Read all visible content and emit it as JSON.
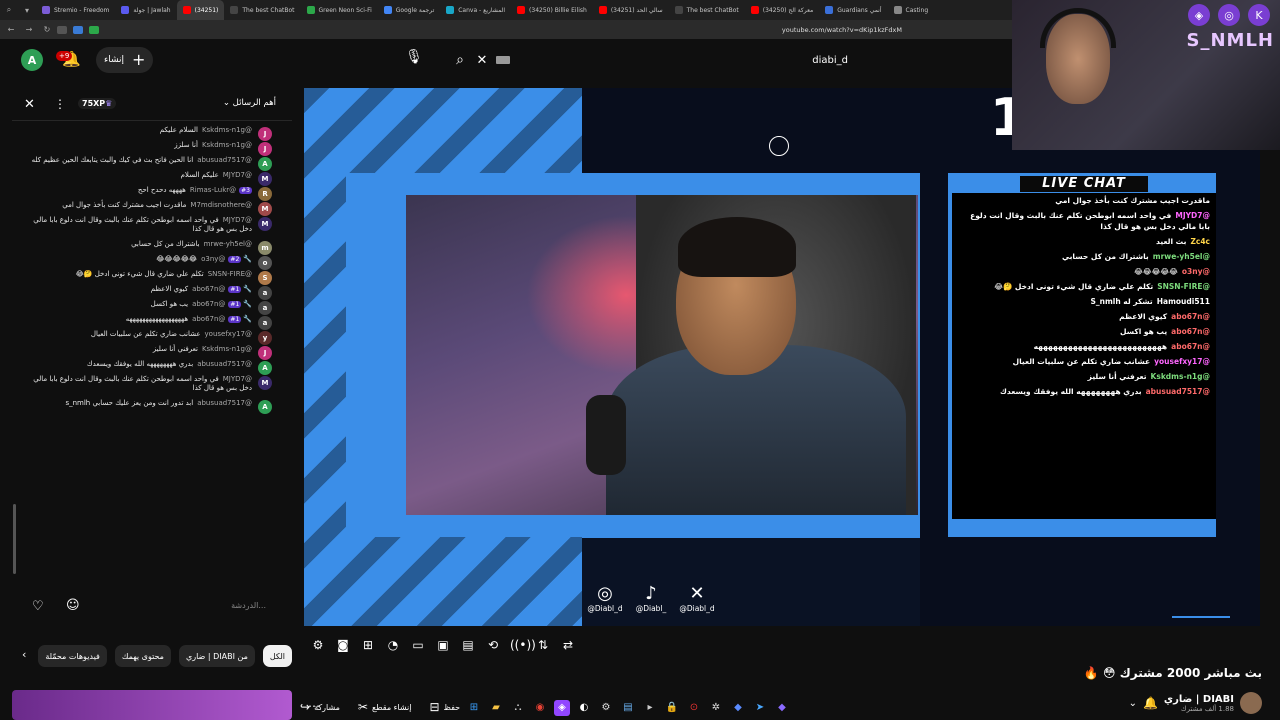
{
  "browser": {
    "tabs": [
      {
        "label": "Stremio - Freedom",
        "color": "#7b5cd6"
      },
      {
        "label": "جولة | Jawlah",
        "color": "#5a5af0"
      },
      {
        "label": "(34251)",
        "color": "#ff0000",
        "active": true
      },
      {
        "label": "The best ChatBot",
        "color": "#444"
      },
      {
        "label": "Green Neon Sci-Fi",
        "color": "#2ca84a"
      },
      {
        "label": "Google ترجمة",
        "color": "#4285f4"
      },
      {
        "label": "Canva - المشاريع",
        "color": "#19a7c8"
      },
      {
        "label": "(34250) Billie Eilish",
        "color": "#ff0000"
      },
      {
        "label": "(34251) سالي الحد",
        "color": "#ff0000"
      },
      {
        "label": "The best ChatBot",
        "color": "#444"
      },
      {
        "label": "(34250) معركة الح",
        "color": "#ff0000"
      },
      {
        "label": "Guardians أنمي",
        "color": "#3a6fd8"
      },
      {
        "label": "Casting",
        "color": "#888"
      }
    ],
    "url": "youtube.com/watch?v=dKip1kzFdxM"
  },
  "header": {
    "avatar_letter": "A",
    "notification_count": "+9",
    "create_label": "إنشاء",
    "search_query": "diabi_d"
  },
  "chat": {
    "mode_label": "أهم الرسائل",
    "xp_label": "75XP",
    "input_placeholder": "الدردشة...",
    "messages": [
      {
        "author": "@Kskdms-n1g",
        "text": "السلام عليكم",
        "avatar": "J",
        "color": "#c0307a"
      },
      {
        "author": "@Kskdms-n1g",
        "text": "أنا سلزز",
        "avatar": "J",
        "color": "#c0307a"
      },
      {
        "author": "@abusuad7517",
        "text": "انا الحين فاتح بث في كيك والبث يتابعك الحين عظيم كله",
        "avatar": "A",
        "color": "#2e9e55"
      },
      {
        "author": "@MJYD7",
        "text": "عليكم السلام",
        "avatar": "M",
        "color": "#3a2a6a"
      },
      {
        "author": "@Rimas-Lukr",
        "text": "ههههه دحدح احح",
        "avatar": "R",
        "color": "#8a6a3a",
        "badge": "#3"
      },
      {
        "author": "@M7mdisnothere",
        "text": "ماقدرت اجيب مشترك كنت بأخذ جوال امي",
        "avatar": "M",
        "color": "#a04a4a"
      },
      {
        "author": "@MJYD7",
        "text": "في واحد اسمه ابوطحن تكلم عنك بالبث وقال انت دلوع بابا مالي دخل بس هو قال كذا",
        "avatar": "M",
        "color": "#3a2a6a"
      },
      {
        "author": "@mrwe-yh5el",
        "text": "باشتراك من كل حسابي",
        "avatar": "m",
        "color": "#8a8a6a"
      },
      {
        "author": "@o3ny",
        "text": "😂😂😂😂😂",
        "avatar": "o",
        "color": "#555",
        "badge": "#2",
        "mod": true
      },
      {
        "author": "@SNSN-FIRE",
        "text": "تكلم علي ضاري قال شيء تونى ادخل 🤔😂",
        "avatar": "S",
        "color": "#b07a4a"
      },
      {
        "author": "@abo67n",
        "text": "كيوي الاعظم",
        "avatar": "a",
        "color": "#444",
        "badge": "#1",
        "mod": true
      },
      {
        "author": "@abo67n",
        "text": "يب هو اكسل",
        "avatar": "a",
        "color": "#444",
        "badge": "#1",
        "mod": true
      },
      {
        "author": "@abo67n",
        "text": "ههههههههههههههههههه",
        "avatar": "a",
        "color": "#444",
        "badge": "#1",
        "mod": true
      },
      {
        "author": "@yousefxy17",
        "text": "عشانب ضاري تكلم عن سلبيات العيال",
        "avatar": "y",
        "color": "#5a2a2a"
      },
      {
        "author": "@Kskdms-n1g",
        "text": "تعرفني أنا سليز",
        "avatar": "J",
        "color": "#c0307a"
      },
      {
        "author": "@abusuad7517",
        "text": "بدري ههههههههه الله يوفقك ويسعدك",
        "avatar": "A",
        "color": "#2e9e55"
      },
      {
        "author": "@MJYD7",
        "text": "في واحد اسمه ابوطحن تكلم عنك بالبث وقال انت دلوع بابا مالي دخل بس هو قال كذا",
        "avatar": "M",
        "color": "#3a2a6a"
      },
      {
        "author": "@abusuad7517",
        "text": "ابد تدور انت ومن يعز عليك حسابي s_nmlh",
        "avatar": "A",
        "color": "#2e9e55"
      }
    ]
  },
  "overlay": {
    "livechat_title": "LIVE CHAT",
    "livechat_lines": [
      {
        "name": "",
        "text": "ماقدرت اجيب مشترك كنت بأخذ جوال امي",
        "color": "#ffffff"
      },
      {
        "name": "@MJYD7",
        "text": "في واحد اسمه ابوطحن تكلم عنك بالبث وقال انت دلوع بابا مالي دخل بس هو قال كذا",
        "color": "#ff66ff"
      },
      {
        "name": "Zc4c",
        "text": "بث العيد",
        "color": "#ffd54a"
      },
      {
        "name": "@mrwe-yh5el",
        "text": "باشتراك من كل حسابي",
        "color": "#7ddc7d"
      },
      {
        "name": "@o3ny",
        "text": "😂😂😂😂😂",
        "color": "#ff6a6a"
      },
      {
        "name": "@SNSN-FIRE",
        "text": "تكلم علي ضاري قال شيء تونى ادخل 🤔😂",
        "color": "#7ddc7d"
      },
      {
        "name": "Hamoudi511",
        "text": "تشكر له S_nmlh",
        "color": "#ffffff"
      },
      {
        "name": "@abo67n",
        "text": "كيوي الاعظم",
        "color": "#ff6a6a"
      },
      {
        "name": "@abo67n",
        "text": "يب هو اكسل",
        "color": "#ff6a6a"
      },
      {
        "name": "@abo67n",
        "text": "ههههههههههههههههههههههههههه",
        "color": "#ff6a6a"
      },
      {
        "name": "@yousefxy17",
        "text": "عشانب ضاري تكلم عن سلبيات العيال",
        "color": "#ff66ff"
      },
      {
        "name": "@Kskdms-n1g",
        "text": "تعرفني أنا سليز",
        "color": "#7ddc7d"
      },
      {
        "name": "@abusuad7517",
        "text": "بدري ههههههههه الله يوفقك ويسعدك",
        "color": "#ff6a6a"
      }
    ],
    "socials": [
      {
        "icon": "instagram-icon",
        "glyph": "◎",
        "handle": "@Diabl_d"
      },
      {
        "icon": "tiktok-icon",
        "glyph": "♪",
        "handle": "@Diabl_"
      },
      {
        "icon": "x-icon",
        "glyph": "✕",
        "handle": "@Diabl_d"
      }
    ],
    "streamer_name": "S_NMLH",
    "big_number": "1"
  },
  "chips": {
    "items": [
      {
        "label": "الكل",
        "active": true
      },
      {
        "label": "من DIABI | ضاري"
      },
      {
        "label": "محتوى يهمك"
      },
      {
        "label": "فيديوهات محمّلة"
      }
    ]
  },
  "video": {
    "title": "بث مباشر 2000 مشترك 😳 🔥",
    "channel_name": "DIABI | ضاري",
    "channel_subs": "1.88 ألف مشترك",
    "actions": [
      {
        "label": "حفظ",
        "icon": "bookmark-icon",
        "glyph": "⊟"
      },
      {
        "label": "إنشاء مقطع",
        "icon": "scissors-icon",
        "glyph": "✂"
      },
      {
        "label": "مشاركة",
        "icon": "share-icon",
        "glyph": "↪"
      }
    ]
  },
  "colors": {
    "accent_blue": "#3b8ee8",
    "youtube_red": "#ff0000",
    "badge_purple": "#5b35c8"
  }
}
